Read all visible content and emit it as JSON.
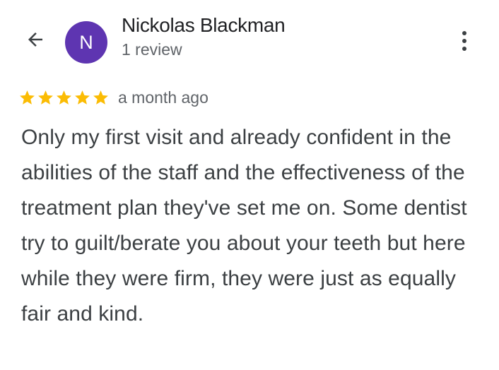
{
  "header": {
    "back_icon": "arrow-back-icon",
    "avatar": {
      "initial": "N",
      "color": "#5e35b1"
    },
    "reviewer_name": "Nickolas Blackman",
    "review_count": "1 review",
    "more_icon": "more-vert-icon"
  },
  "review": {
    "rating": 5,
    "max_rating": 5,
    "star_color": "#fbbc04",
    "time": "a month ago",
    "text": "Only my first visit and already confident in the abilities of the staff and the effectiveness of the treatment plan they've set me on. Some dentist try to guilt/berate you about your teeth but here while they were firm, they were just as equally fair and kind."
  }
}
